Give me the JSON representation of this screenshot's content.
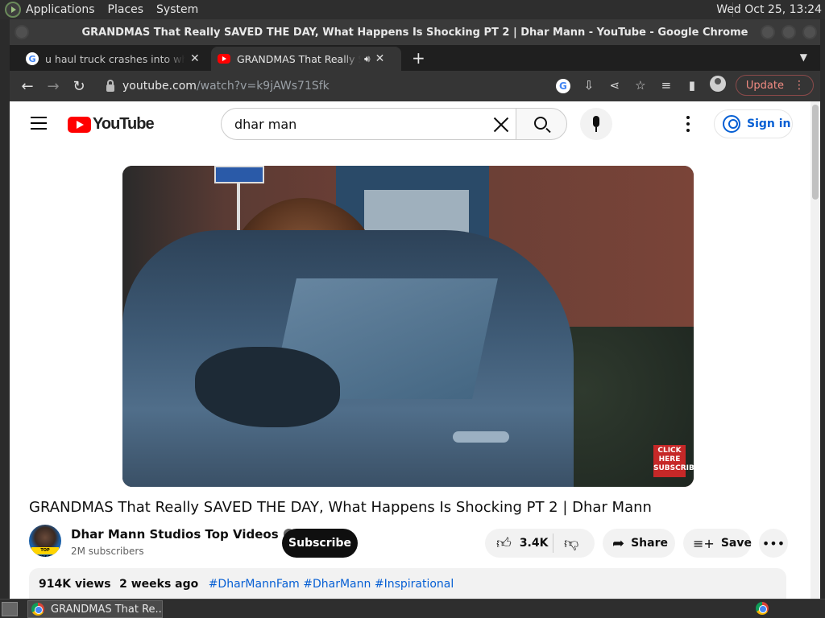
{
  "os": {
    "menus": [
      "Applications",
      "Places",
      "System"
    ],
    "clock": "Wed Oct 25, 13:24",
    "taskbar_task": "GRANDMAS That Re..."
  },
  "window": {
    "title": "GRANDMAS That Really SAVED THE DAY, What Happens Is Shocking PT 2 | Dhar Mann - YouTube - Google Chrome"
  },
  "tabs": [
    {
      "title": "u haul truck crashes into white",
      "favicon": "google-icon"
    },
    {
      "title": "GRANDMAS That Really SAVED",
      "favicon": "youtube-icon",
      "audio": true
    }
  ],
  "address": {
    "host": "youtube.com",
    "path": "/watch?v=k9jAWs71Sfk",
    "update_label": "Update"
  },
  "youtube": {
    "wordmark": "YouTube",
    "search_query": "dhar man",
    "signin_label": "Sign in"
  },
  "video": {
    "title": "GRANDMAS That Really SAVED THE DAY, What Happens Is Shocking PT 2 | Dhar Mann",
    "badge": "CLICK HERE SUBSCRIBE",
    "channel_name": "Dhar Mann Studios Top Videos",
    "channel_avatar_tag": "TOP VIDEOS",
    "subscribers": "2M subscribers",
    "subscribe_label": "Subscribe",
    "likes": "3.4K",
    "share_label": "Share",
    "save_label": "Save",
    "views": "914K views",
    "age": "2 weeks ago",
    "hashtags": "#DharMannFam #DharMann #Inspirational"
  },
  "colors": {
    "brand_red": "#ff0000",
    "link_blue": "#065fd4",
    "update_red": "#f28b82"
  }
}
